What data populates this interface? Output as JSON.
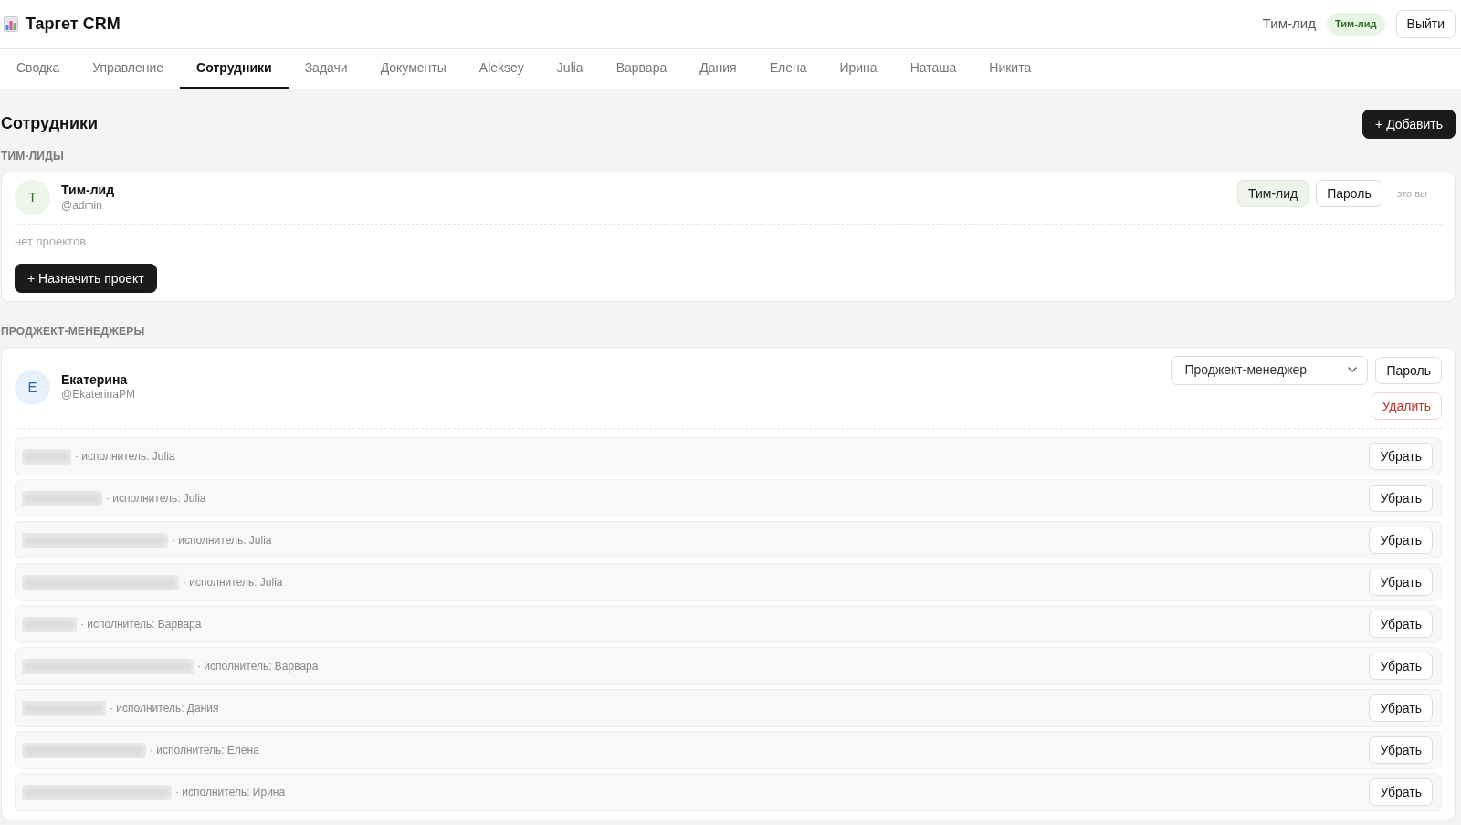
{
  "header": {
    "app_title": "Таргет CRM",
    "user_name": "Тим-лид",
    "role_badge": "Тим-лид",
    "logout_button": "Выйти"
  },
  "tabs": [
    {
      "label": "Сводка",
      "selected": false
    },
    {
      "label": "Управление",
      "selected": false
    },
    {
      "label": "Сотрудники",
      "selected": true
    },
    {
      "label": "Задачи",
      "selected": false
    },
    {
      "label": "Документы",
      "selected": false
    },
    {
      "label": "Aleksey",
      "selected": false
    },
    {
      "label": "Julia",
      "selected": false
    },
    {
      "label": "Варвара",
      "selected": false
    },
    {
      "label": "Дания",
      "selected": false
    },
    {
      "label": "Елена",
      "selected": false
    },
    {
      "label": "Ирина",
      "selected": false
    },
    {
      "label": "Наташа",
      "selected": false
    },
    {
      "label": "Никита",
      "selected": false
    }
  ],
  "page": {
    "title": "Сотрудники",
    "add_button": "+ Добавить"
  },
  "sections": [
    {
      "heading": "ТИМ-ЛИДЫ",
      "members": [
        {
          "kind": "lead",
          "initial": "Т",
          "name": "Тим-лид",
          "username": "@admin",
          "role": "Тим-лид",
          "password_button": "Пароль",
          "self_note": "это вы",
          "empty_note": "нет проектов",
          "assign_button": "+ Назначить проект"
        }
      ]
    },
    {
      "heading": "ПРОДЖЕКТ-МЕНЕДЖЕРЫ",
      "members": [
        {
          "kind": "manager",
          "initial": "Е",
          "name": "Екатерина",
          "username": "@EkaterinaPM",
          "role": "Проджект-менеджер",
          "password_button": "Пароль",
          "delete_button": "Удалить",
          "projects": [
            {
              "executor": "· исполнитель: Julia",
              "remove_button": "Убрать"
            },
            {
              "executor": "· исполнитель: Julia",
              "remove_button": "Убрать"
            },
            {
              "executor": "· исполнитель: Julia",
              "remove_button": "Убрать"
            },
            {
              "executor": "· исполнитель: Julia",
              "remove_button": "Убрать"
            },
            {
              "executor": "· исполнитель: Варвара",
              "remove_button": "Убрать"
            },
            {
              "executor": "· исполнитель: Варвара",
              "remove_button": "Убрать"
            },
            {
              "executor": "· исполнитель: Дания",
              "remove_button": "Убрать"
            },
            {
              "executor": "· исполнитель: Елена",
              "remove_button": "Убрать"
            },
            {
              "executor": "· исполнитель: Ирина",
              "remove_button": "Убрать"
            }
          ]
        }
      ]
    }
  ]
}
